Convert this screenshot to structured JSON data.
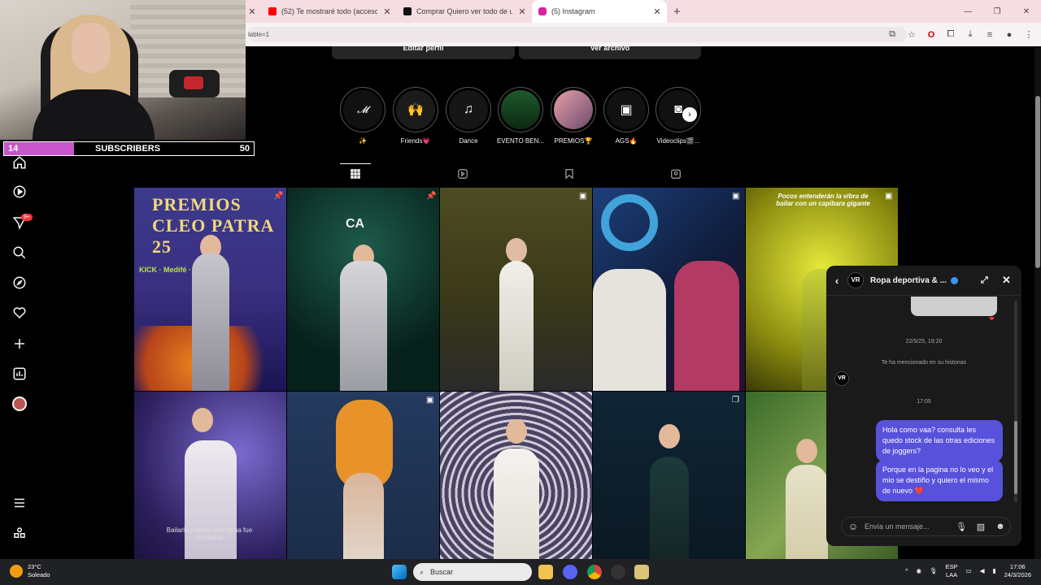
{
  "browser": {
    "tabs": [
      {
        "title": "(52) Te mostraré todo (acceso e",
        "color": "#ff0000"
      },
      {
        "title": "Comprar Quiero ver todo de un",
        "color": "#111111"
      },
      {
        "title": "(5) Instagram",
        "color": "#d6249f"
      }
    ],
    "url_text": "lable=1"
  },
  "webcam": {
    "subscribers_current": "14",
    "subscribers_label": "SUBSCRIBERS",
    "subscribers_goal": "50",
    "progress_fraction": 0.28
  },
  "profile": {
    "edit_profile": "Editar perfil",
    "view_archive": "Ver archivo"
  },
  "highlights": [
    {
      "label": "✨",
      "icon": "logo"
    },
    {
      "label": "Friends💗",
      "icon": "hands"
    },
    {
      "label": "Dance",
      "icon": "music"
    },
    {
      "label": "EVENTO BEN...",
      "icon": "event"
    },
    {
      "label": "PREMIOS🏆",
      "icon": "photo"
    },
    {
      "label": "AGS🔥",
      "icon": "gallery"
    },
    {
      "label": "Videoclips🎬...",
      "icon": "camera"
    }
  ],
  "posts": [
    {
      "title": "PREMIOS CLEO PATRA 25",
      "brands": "KICK · Medifé · premujer",
      "overlay": "pin"
    },
    {
      "title": "CA",
      "overlay": "pin"
    },
    {
      "overlay": "reel"
    },
    {
      "overlay": "reel"
    },
    {
      "caption": "Pocos entenderán la vibra de bailar con un capibara gigante",
      "overlay": "reel"
    },
    {
      "caption": "Bailarlo y sentir este tema fue inevitable",
      "overlay": ""
    },
    {
      "overlay": "reel"
    },
    {
      "overlay": ""
    },
    {
      "overlay": "carousel"
    },
    {
      "overlay": ""
    }
  ],
  "chat": {
    "avatar_initials": "VR",
    "name": "Ropa deportiva & ...",
    "timestamp1": "22/5/25, 19:20",
    "mention_text": "Te ha mencionado en su historias",
    "timestamp2": "17:05",
    "messages": [
      "Hola como vaa? consulta les quedo stock de las otras ediciones de joggers?",
      "Porque en la pagina no lo veo y el mio se destiño y quiero el mismo de nuevo ❤️"
    ],
    "input_placeholder": "Envía un mensaje..."
  },
  "nav_badge": "9+",
  "taskbar": {
    "temperature": "23°C",
    "weather": "Soleado",
    "search_label": "Buscar",
    "lang1": "ESP",
    "lang2": "LAA",
    "time": "17:06",
    "date": "24/3/2026"
  },
  "colors": {
    "accent_message": "#5851db",
    "subscriber_bar": "#c656c9",
    "notification": "#ff3040"
  }
}
